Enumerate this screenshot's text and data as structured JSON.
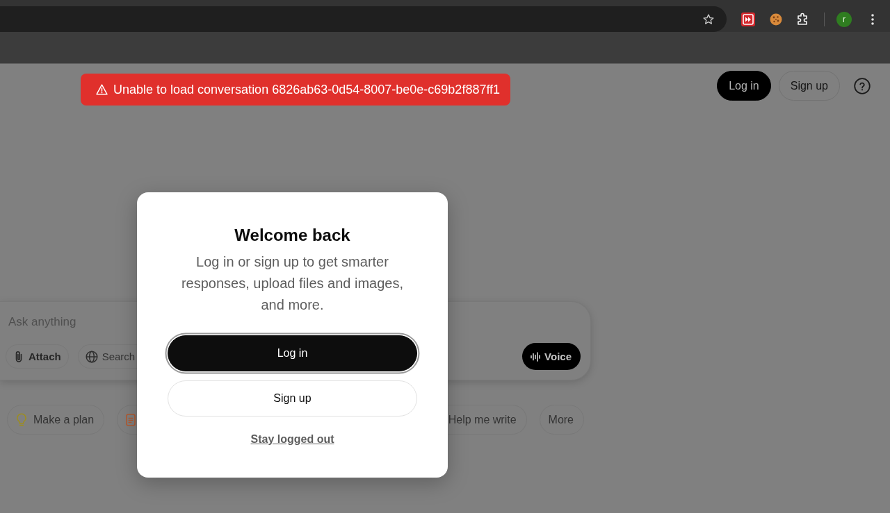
{
  "browser": {
    "profile_initial": "r"
  },
  "error_toast": {
    "message": "Unable to load conversation 6826ab63-0d54-8007-be0e-c69b2f887ff1"
  },
  "header": {
    "buttons": [
      {
        "label": "Log in",
        "kind": "primary"
      },
      {
        "label": "Sign up",
        "kind": "secondary"
      }
    ]
  },
  "composer": {
    "placeholder": "Ask anything",
    "tools": [
      {
        "label": "Attach",
        "kind": "attach"
      },
      {
        "label": "Search",
        "kind": "search"
      }
    ],
    "voice": "Voice"
  },
  "suggestions": [
    {
      "kind": "bulb",
      "label": "Make a plan"
    },
    {
      "kind": "doc"
    },
    {
      "kind": "plain",
      "label": "Help me write"
    },
    {
      "kind": "plain",
      "label": "More"
    }
  ],
  "modal": {
    "title": "Welcome back",
    "text": "Log in or sign up to get smarter responses, upload files and images, and more.",
    "buttons": [
      {
        "label": "Log in",
        "kind": "primary",
        "focused": true
      },
      {
        "label": "Sign up",
        "kind": "secondary",
        "focused": false
      }
    ],
    "link": "Stay logged out"
  }
}
